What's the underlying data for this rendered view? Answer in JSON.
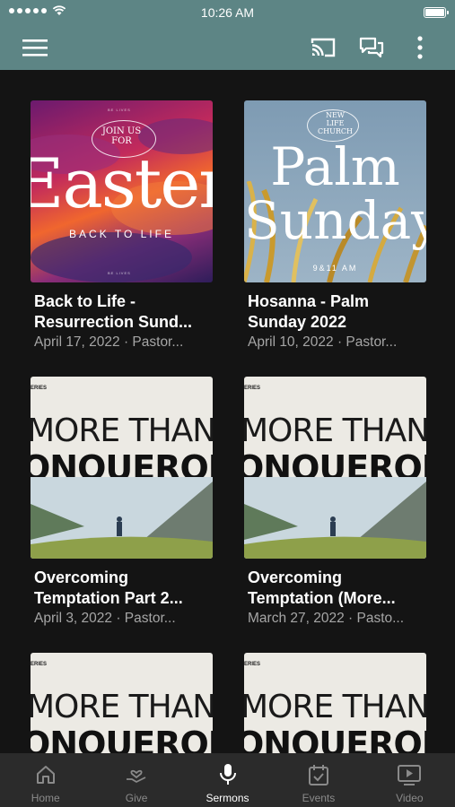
{
  "status_bar": {
    "time": "10:26 AM"
  },
  "app_bar": {
    "icons": [
      "menu-icon",
      "cast-icon",
      "chat-icon",
      "more-vert-icon"
    ]
  },
  "sermons": [
    {
      "title": "Back to Life -\nResurrection Sund...",
      "meta": "April 17, 2022 · Pastor...",
      "thumb": {
        "kind": "easter",
        "overline": "JOIN US\nFOR",
        "big": "Easter",
        "sub": "BACK TO LIFE"
      }
    },
    {
      "title": "Hosanna - Palm\nSunday 2022",
      "meta": "April 10, 2022 · Pastor...",
      "thumb": {
        "kind": "palm",
        "church": "NEW\nLIFE\nCHURCH",
        "big1": "Palm",
        "big2": "Sunday",
        "time": "9&11 AM"
      }
    },
    {
      "title": "Overcoming\nTemptation Part 2...",
      "meta": "April 3, 2022 · Pastor...",
      "thumb": {
        "kind": "mtc",
        "series": "ERIES",
        "line1": "MORE THAN",
        "line2": "ONQUEROR"
      }
    },
    {
      "title": "Overcoming\nTemptation (More...",
      "meta": "March 27, 2022 · Pasto...",
      "thumb": {
        "kind": "mtc",
        "series": "ERIES",
        "line1": "MORE THAN",
        "line2": "ONQUEROR"
      }
    },
    {
      "title": "",
      "meta": "",
      "thumb": {
        "kind": "mtc",
        "series": "ERIES",
        "line1": "MORE THAN",
        "line2": "ONQUEROR"
      }
    },
    {
      "title": "",
      "meta": "",
      "thumb": {
        "kind": "mtc",
        "series": "ERIES",
        "line1": "MORE THAN",
        "line2": "ONQUEROR"
      }
    }
  ],
  "tabs": [
    {
      "label": "Home",
      "icon": "home-icon",
      "active": false
    },
    {
      "label": "Give",
      "icon": "give-icon",
      "active": false
    },
    {
      "label": "Sermons",
      "icon": "microphone-icon",
      "active": true
    },
    {
      "label": "Events",
      "icon": "calendar-icon",
      "active": false
    },
    {
      "label": "Video",
      "icon": "video-icon",
      "active": false
    }
  ],
  "colors": {
    "header": "#5d8585",
    "background": "#141414",
    "tab_bar": "#2b2b2b",
    "meta_text": "#a6a6a6"
  }
}
